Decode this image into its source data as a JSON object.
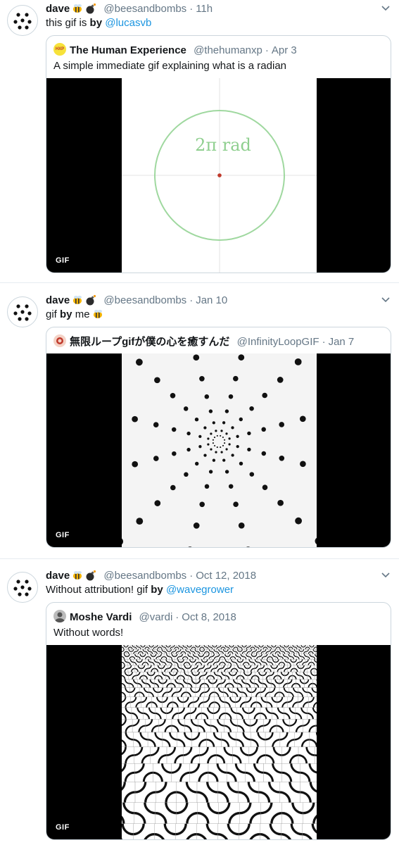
{
  "tweets": [
    {
      "name": "dave",
      "handle": "@beesandbombs",
      "time": "11h",
      "text_before": "this gif is ",
      "text_bold": "by",
      "text_after": " ",
      "mention": "@lucasvb",
      "quote": {
        "avatar_label": "HXP",
        "name": "The Human Experience",
        "handle": "@thehumanxp",
        "date": "Apr 3",
        "text": "A simple immediate gif explaining what is a radian",
        "media_text": "2π rad",
        "gif_label": "GIF"
      }
    },
    {
      "name": "dave",
      "handle": "@beesandbombs",
      "time": "Jan 10",
      "text_before": "gif ",
      "text_bold": "by",
      "text_after": " me",
      "mention": "",
      "quote": {
        "name": "無限ループgifが僕の心を癒すんだ",
        "handle": "@InfinityLoopGIF",
        "date": "Jan 7",
        "text": "",
        "gif_label": "GIF"
      }
    },
    {
      "name": "dave",
      "handle": "@beesandbombs",
      "time": "Oct 12, 2018",
      "text_before": "Without attribution! gif ",
      "text_bold": "by",
      "text_after": " ",
      "mention": "@wavegrower",
      "quote": {
        "name": "Moshe Vardi",
        "handle": "@vardi",
        "date": "Oct 8, 2018",
        "text": "Without words!",
        "gif_label": "GIF"
      }
    }
  ],
  "icons": {
    "avatar": "dots-avatar-icon",
    "emoji_1": "bee-emoji-icon",
    "emoji_2": "bomb-emoji-icon",
    "menu": "chevron-down-icon"
  },
  "colors": {
    "link": "#1b95e0",
    "meta": "#657786",
    "border": "#ccd6dd",
    "circle": "#9fd89f",
    "center_dot": "#c0392b"
  }
}
